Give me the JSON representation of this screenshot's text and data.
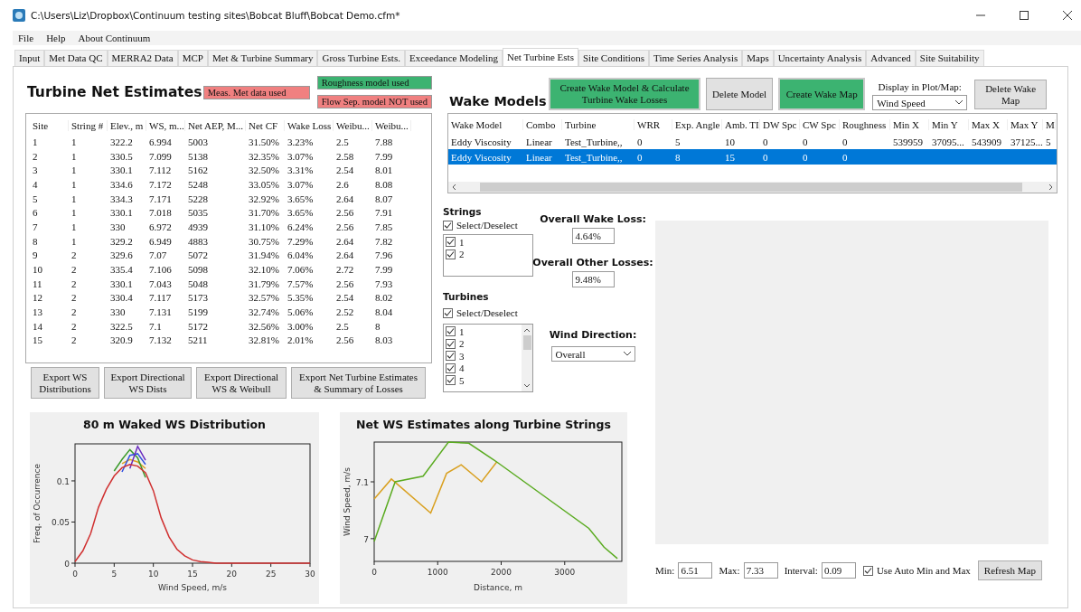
{
  "window": {
    "title": "C:\\Users\\Liz\\Dropbox\\Continuum testing sites\\Bobcat Bluff\\Bobcat Demo.cfm*"
  },
  "menu": [
    "File",
    "Help",
    "About Continuum"
  ],
  "tabs": [
    {
      "label": "Input",
      "selected": false
    },
    {
      "label": "Met Data QC",
      "selected": false
    },
    {
      "label": "MERRA2 Data",
      "selected": false
    },
    {
      "label": "MCP",
      "selected": false
    },
    {
      "label": "Met & Turbine Summary",
      "selected": false
    },
    {
      "label": "Gross Turbine Ests.",
      "selected": false
    },
    {
      "label": "Exceedance Modeling",
      "selected": false
    },
    {
      "label": "Net Turbine Ests",
      "selected": true
    },
    {
      "label": "Site Conditions",
      "selected": false
    },
    {
      "label": "Time Series Analysis",
      "selected": false
    },
    {
      "label": "Maps",
      "selected": false
    },
    {
      "label": "Uncertainty Analysis",
      "selected": false
    },
    {
      "label": "Advanced",
      "selected": false
    },
    {
      "label": "Site Suitability",
      "selected": false
    }
  ],
  "net_estimates": {
    "title": "Turbine Net Estimates",
    "badges": [
      {
        "label": "Meas. Met data used",
        "color": "#f08080"
      },
      {
        "label": "Roughness model used",
        "color": "#3cb371"
      },
      {
        "label": "Flow Sep. model NOT used",
        "color": "#f08080"
      }
    ],
    "table": {
      "columns": [
        "Site",
        "String #",
        "Elev., m",
        "WS, m...",
        "Net AEP, M...",
        "Net CF",
        "Wake Loss",
        "Weibu...",
        "Weibu..."
      ],
      "rows": [
        [
          "1",
          "1",
          "322.2",
          "6.994",
          "5003",
          "31.50%",
          "3.23%",
          "2.5",
          "7.88"
        ],
        [
          "2",
          "1",
          "330.5",
          "7.099",
          "5138",
          "32.35%",
          "3.07%",
          "2.58",
          "7.99"
        ],
        [
          "3",
          "1",
          "330.1",
          "7.112",
          "5162",
          "32.50%",
          "3.31%",
          "2.54",
          "8.01"
        ],
        [
          "4",
          "1",
          "334.6",
          "7.172",
          "5248",
          "33.05%",
          "3.07%",
          "2.6",
          "8.08"
        ],
        [
          "5",
          "1",
          "334.3",
          "7.171",
          "5228",
          "32.92%",
          "3.65%",
          "2.64",
          "8.07"
        ],
        [
          "6",
          "1",
          "330.1",
          "7.018",
          "5035",
          "31.70%",
          "3.65%",
          "2.56",
          "7.91"
        ],
        [
          "7",
          "1",
          "330",
          "6.972",
          "4939",
          "31.10%",
          "6.24%",
          "2.56",
          "7.85"
        ],
        [
          "8",
          "1",
          "329.2",
          "6.949",
          "4883",
          "30.75%",
          "7.29%",
          "2.64",
          "7.82"
        ],
        [
          "9",
          "2",
          "329.6",
          "7.07",
          "5072",
          "31.94%",
          "6.04%",
          "2.64",
          "7.96"
        ],
        [
          "10",
          "2",
          "335.4",
          "7.106",
          "5098",
          "32.10%",
          "7.06%",
          "2.72",
          "7.99"
        ],
        [
          "11",
          "2",
          "330.1",
          "7.043",
          "5048",
          "31.79%",
          "7.57%",
          "2.56",
          "7.93"
        ],
        [
          "12",
          "2",
          "330.4",
          "7.117",
          "5173",
          "32.57%",
          "5.35%",
          "2.54",
          "8.02"
        ],
        [
          "13",
          "2",
          "330",
          "7.131",
          "5199",
          "32.74%",
          "5.06%",
          "2.52",
          "8.04"
        ],
        [
          "14",
          "2",
          "322.5",
          "7.1",
          "5172",
          "32.56%",
          "3.00%",
          "2.5",
          "8"
        ],
        [
          "15",
          "2",
          "320.9",
          "7.132",
          "5211",
          "32.81%",
          "2.01%",
          "2.56",
          "8.03"
        ]
      ]
    },
    "export_buttons": [
      "Export WS Distributions",
      "Export Directional WS Dists",
      "Export Directional WS & Weibull",
      "Export Net Turbine Estimates & Summary of Losses"
    ]
  },
  "wake_models": {
    "title": "Wake Models",
    "buttons": [
      {
        "label": "Create Wake Model & Calculate Turbine Wake Losses",
        "kind": "primary"
      },
      {
        "label": "Delete Model",
        "kind": "default"
      },
      {
        "label": "Create Wake Map",
        "kind": "primary"
      }
    ],
    "display": {
      "label": "Display in Plot/Map:",
      "value": "Wind Speed"
    },
    "delete_map_button": "Delete Wake Map",
    "table": {
      "columns": [
        "Wake Model",
        "Combo",
        "Turbine",
        "WRR",
        "Exp. Angle",
        "Amb. TI",
        "DW Spc",
        "CW Spc",
        "Roughness",
        "Min X",
        "Min Y",
        "Max X",
        "Max Y",
        "M"
      ],
      "rows": [
        {
          "cells": [
            "Eddy Viscosity",
            "Linear",
            "Test_Turbine,,",
            "0",
            "5",
            "10",
            "0",
            "0",
            "0",
            "539959",
            "37095...",
            "543909",
            "37125...",
            "5"
          ],
          "selected": false
        },
        {
          "cells": [
            "Eddy Viscosity",
            "Linear",
            "Test_Turbine,,",
            "0",
            "8",
            "15",
            "0",
            "0",
            "0"
          ],
          "selected": true
        }
      ]
    }
  },
  "strings": {
    "title": "Strings",
    "select_all": {
      "label": "Select/Deselect",
      "checked": true
    },
    "items": [
      {
        "label": "1",
        "checked": true
      },
      {
        "label": "2",
        "checked": true
      }
    ]
  },
  "turbines": {
    "title": "Turbines",
    "select_all": {
      "label": "Select/Deselect",
      "checked": true
    },
    "items": [
      {
        "label": "1",
        "checked": true
      },
      {
        "label": "2",
        "checked": true
      },
      {
        "label": "3",
        "checked": true
      },
      {
        "label": "4",
        "checked": true
      },
      {
        "label": "5",
        "checked": true
      }
    ]
  },
  "overall_wake_loss": {
    "label": "Overall Wake Loss:",
    "value": "4.64%"
  },
  "overall_other_losses": {
    "label": "Overall Other Losses:",
    "value": "9.48%"
  },
  "wind_direction": {
    "label": "Wind Direction:",
    "value": "Overall"
  },
  "charts": [
    {
      "chart_data": {
        "type": "line",
        "title": "80 m Waked WS Distribution",
        "xlabel": "Wind Speed, m/s",
        "ylabel": "Freq. of Occurrence",
        "x": [
          0,
          1,
          2,
          3,
          4,
          5,
          6,
          7,
          8,
          9,
          10,
          11,
          12,
          13,
          14,
          15,
          16,
          17,
          18,
          30
        ],
        "series": [
          {
            "color": "#e0a020",
            "values": [
              null,
              null,
              null,
              null,
              null,
              null,
              0.121,
              0.126,
              0.123,
              0.115,
              null,
              null,
              null,
              null,
              null,
              null,
              null,
              null,
              null,
              null
            ]
          },
          {
            "color": "#3a9a2a",
            "values": [
              null,
              null,
              null,
              null,
              null,
              0.112,
              0.126,
              0.138,
              0.128,
              0.104,
              null,
              null,
              null,
              null,
              null,
              null,
              null,
              null,
              null,
              null
            ]
          },
          {
            "color": "#3050e0",
            "values": [
              null,
              null,
              null,
              null,
              null,
              null,
              0.111,
              0.131,
              0.133,
              0.12,
              null,
              null,
              null,
              null,
              null,
              null,
              null,
              null,
              null,
              null
            ]
          },
          {
            "color": "#6a2bbf",
            "values": [
              null,
              null,
              null,
              null,
              null,
              null,
              null,
              0.115,
              0.142,
              0.125,
              null,
              null,
              null,
              null,
              null,
              null,
              null,
              null,
              null,
              null
            ]
          },
          {
            "color": "#d03030",
            "values": [
              0.002,
              0.015,
              0.036,
              0.068,
              0.09,
              0.106,
              0.116,
              0.12,
              0.118,
              0.11,
              0.088,
              0.055,
              0.032,
              0.017,
              0.009,
              0.004,
              0.002,
              0.001,
              0,
              0
            ]
          }
        ],
        "xlim": [
          0,
          30
        ],
        "ylim": [
          0,
          0.145
        ],
        "xticks": [
          0,
          5,
          10,
          15,
          20,
          25,
          30
        ],
        "yticks": [
          0,
          0.05,
          0.1
        ]
      }
    },
    {
      "chart_data": {
        "type": "line",
        "title": "Net WS Estimates along Turbine Strings",
        "xlabel": "Distance, m",
        "ylabel": "Wind Speed, m/s",
        "series": [
          {
            "color": "#d9a020",
            "x": [
              0,
              270,
              890,
              1140,
              1370,
              1690,
              1930
            ],
            "values": [
              7.07,
              7.105,
              7.045,
              7.115,
              7.13,
              7.1,
              7.135
            ]
          },
          {
            "color": "#5aab20",
            "x": [
              0,
              330,
              770,
              1170,
              1490,
              1930,
              3380,
              3620,
              3830
            ],
            "values": [
              6.995,
              7.1,
              7.11,
              7.17,
              7.168,
              7.135,
              7.018,
              6.985,
              6.965
            ]
          }
        ],
        "xlim": [
          0,
          3900
        ],
        "ylim": [
          6.96,
          7.17
        ],
        "xticks": [
          0,
          1000,
          2000,
          3000
        ],
        "yticks": [
          7,
          7.1
        ]
      }
    }
  ],
  "map_range": {
    "min": {
      "label": "Min:",
      "value": "6.51"
    },
    "max": {
      "label": "Max:",
      "value": "7.33"
    },
    "interval": {
      "label": "Interval:",
      "value": "0.09"
    },
    "auto": {
      "label": "Use Auto Min and Max",
      "checked": true
    },
    "refresh_button": "Refresh Map"
  }
}
